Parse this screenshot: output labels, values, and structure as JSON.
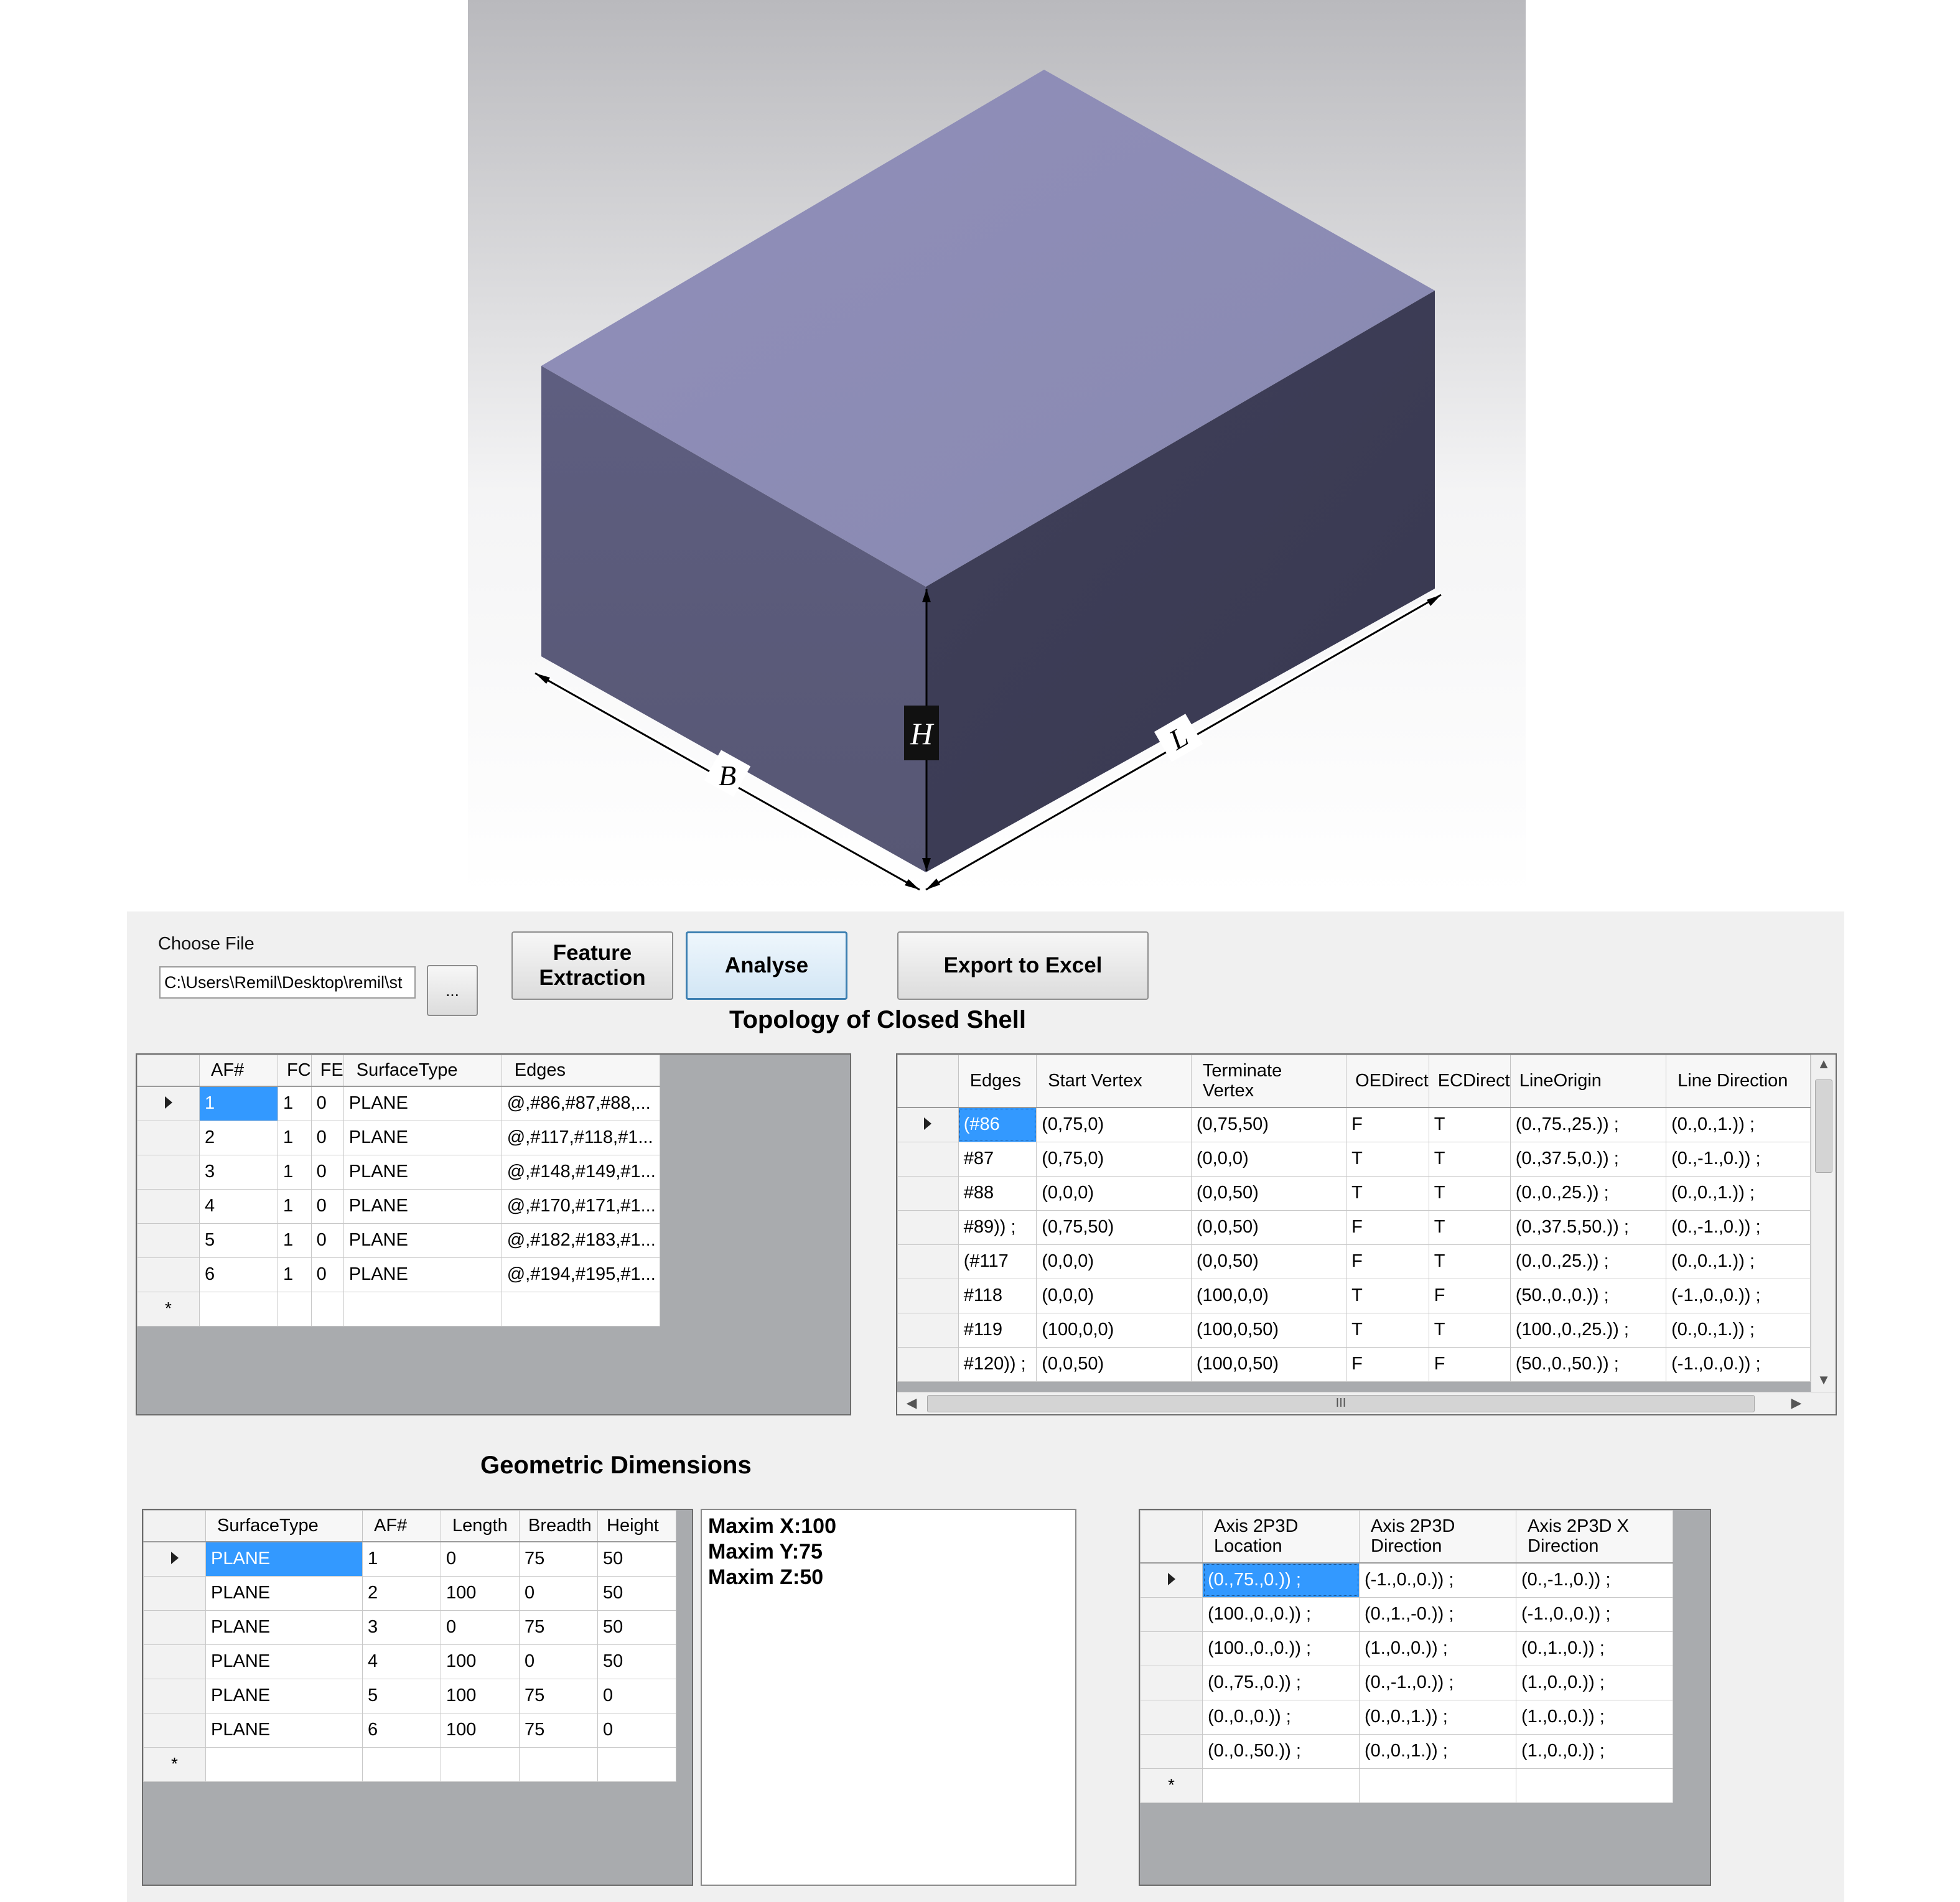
{
  "diagram": {
    "labels": {
      "height": "H",
      "breadth": "B",
      "length": "L"
    }
  },
  "app": {
    "choose_file_label": "Choose File",
    "file_path": "C:\\Users\\Remil\\Desktop\\remil\\st",
    "browse_label": "...",
    "feature_extraction_label": "Feature\nExtraction",
    "analyse_label": "Analyse",
    "export_label": "Export to Excel",
    "topology_heading": "Topology of Closed Shell",
    "geometric_heading": "Geometric Dimensions"
  },
  "faces_table": {
    "columns": [
      "AF#",
      "FC",
      "FE",
      "SurfaceType",
      "Edges"
    ],
    "rows": [
      [
        "1",
        "1",
        "0",
        "PLANE",
        "@,#86,#87,#88,..."
      ],
      [
        "2",
        "1",
        "0",
        "PLANE",
        "@,#117,#118,#1..."
      ],
      [
        "3",
        "1",
        "0",
        "PLANE",
        "@,#148,#149,#1..."
      ],
      [
        "4",
        "1",
        "0",
        "PLANE",
        "@,#170,#171,#1..."
      ],
      [
        "5",
        "1",
        "0",
        "PLANE",
        "@,#182,#183,#1..."
      ],
      [
        "6",
        "1",
        "0",
        "PLANE",
        "@,#194,#195,#1..."
      ]
    ]
  },
  "edges_table": {
    "columns": [
      "Edges",
      "Start Vertex",
      "Terminate\nVertex",
      "OEDirect",
      "ECDirect",
      "LineOrigin",
      "Line Direction"
    ],
    "rows": [
      [
        "(#86",
        "(0,75,0)",
        "(0,75,50)",
        "F",
        "T",
        "(0.,75.,25.)) ;",
        "(0.,0.,1.)) ;"
      ],
      [
        "#87",
        "(0,75,0)",
        "(0,0,0)",
        "T",
        "T",
        "(0.,37.5,0.)) ;",
        "(0.,-1.,0.)) ;"
      ],
      [
        "#88",
        "(0,0,0)",
        "(0,0,50)",
        "T",
        "T",
        "(0.,0.,25.)) ;",
        "(0.,0.,1.)) ;"
      ],
      [
        "#89)) ;",
        "(0,75,50)",
        "(0,0,50)",
        "F",
        "T",
        "(0.,37.5,50.)) ;",
        "(0.,-1.,0.)) ;"
      ],
      [
        "(#117",
        "(0,0,0)",
        "(0,0,50)",
        "F",
        "T",
        "(0.,0.,25.)) ;",
        "(0.,0.,1.)) ;"
      ],
      [
        "#118",
        "(0,0,0)",
        "(100,0,0)",
        "T",
        "F",
        "(50.,0.,0.)) ;",
        "(-1.,0.,0.)) ;"
      ],
      [
        "#119",
        "(100,0,0)",
        "(100,0,50)",
        "T",
        "T",
        "(100.,0.,25.)) ;",
        "(0.,0.,1.)) ;"
      ],
      [
        "#120)) ;",
        "(0,0,50)",
        "(100,0,50)",
        "F",
        "F",
        "(50.,0.,50.)) ;",
        "(-1.,0.,0.)) ;"
      ]
    ],
    "scroll_grip": "III"
  },
  "dimensions_table": {
    "columns": [
      "SurfaceType",
      "AF#",
      "Length",
      "Breadth",
      "Height"
    ],
    "rows": [
      [
        "PLANE",
        "1",
        "0",
        "75",
        "50"
      ],
      [
        "PLANE",
        "2",
        "100",
        "0",
        "50"
      ],
      [
        "PLANE",
        "3",
        "0",
        "75",
        "50"
      ],
      [
        "PLANE",
        "4",
        "100",
        "0",
        "50"
      ],
      [
        "PLANE",
        "5",
        "100",
        "75",
        "0"
      ],
      [
        "PLANE",
        "6",
        "100",
        "75",
        "0"
      ]
    ]
  },
  "maxima": [
    "Maxim X:100",
    "Maxim Y:75",
    "Maxim Z:50"
  ],
  "axis_table": {
    "columns": [
      "Axis  2P3D\nLocation",
      "Axis 2P3D\nDirection",
      "Axis 2P3D X\nDirection"
    ],
    "rows": [
      [
        "(0.,75.,0.)) ;",
        "(-1.,0.,0.)) ;",
        "(0.,-1.,0.)) ;"
      ],
      [
        "(100.,0.,0.)) ;",
        "(0.,1.,-0.)) ;",
        "(-1.,0.,0.)) ;"
      ],
      [
        "(100.,0.,0.)) ;",
        "(1.,0.,0.)) ;",
        "(0.,1.,0.)) ;"
      ],
      [
        "(0.,75.,0.)) ;",
        "(0.,-1.,0.)) ;",
        "(1.,0.,0.)) ;"
      ],
      [
        "(0.,0.,0.)) ;",
        "(0.,0.,1.)) ;",
        "(1.,0.,0.)) ;"
      ],
      [
        "(0.,0.,50.)) ;",
        "(0.,0.,1.)) ;",
        "(1.,0.,0.)) ;"
      ]
    ]
  },
  "colors": {
    "box_top": "#908fb8",
    "box_left": "#5b5b7b",
    "box_right": "#3d3d54",
    "selection": "#3399ff"
  }
}
